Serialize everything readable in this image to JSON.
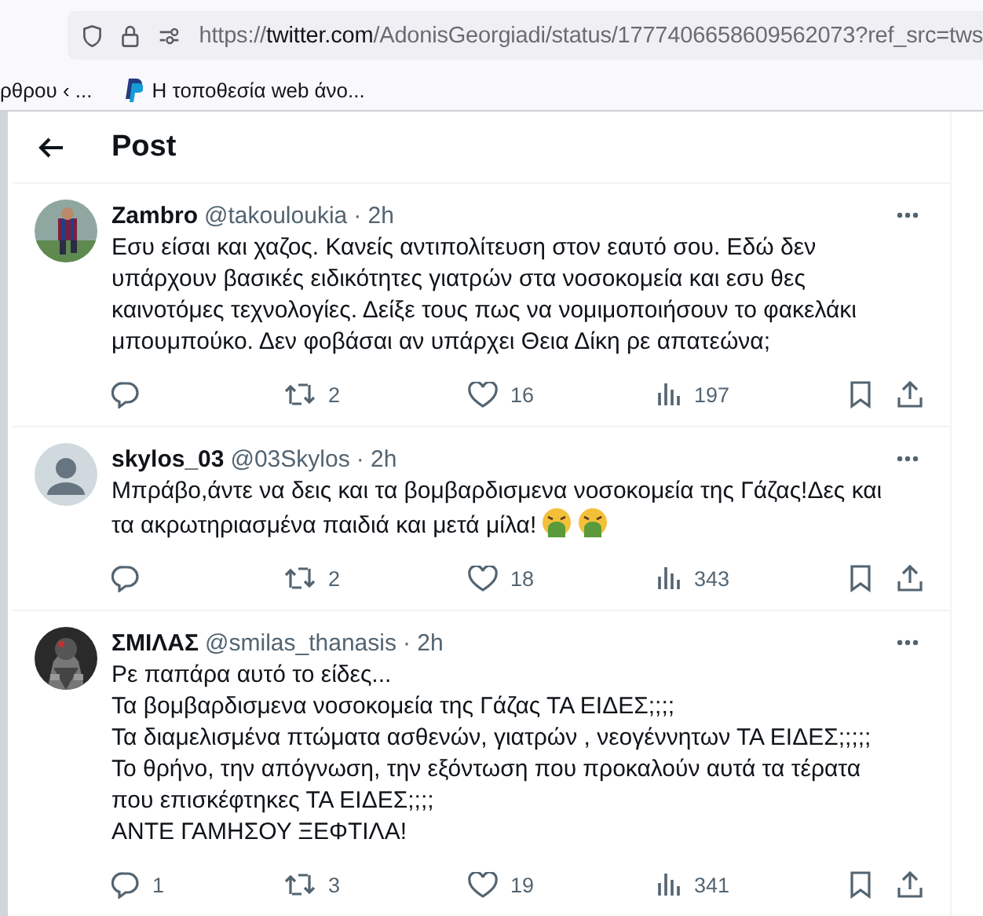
{
  "browser": {
    "url_scheme": "https://",
    "url_host": "twitter.com",
    "url_path": "/AdonisGeorgiadi/status/1777406658609562073?ref_src=tws"
  },
  "bookmarks": [
    {
      "kind": "plain",
      "label": "ρθρου ‹ ..."
    },
    {
      "kind": "paypal",
      "label": "Η τοποθεσία web άνο..."
    }
  ],
  "header": {
    "title": "Post"
  },
  "posts": [
    {
      "name": "Zambro",
      "handle": "@takouloukia",
      "time": "· 2h",
      "lines": [
        "Εσυ είσαι και χαζος. Κανείς αντιπολίτευση στον εαυτό σου. Εδώ δεν",
        "υπάρχουν βασικές ειδικότητες γιατρών στα νοσοκομεία και εσυ θες",
        "καινοτόμες τεχνολογίες. Δείξε τους πως να νομιμοποιήσουν το φακελάκι",
        "μπουμπούκο. Δεν φοβάσαι αν υπάρχει Θεια Δίκη ρε απατεώνα;"
      ],
      "reposts": "2",
      "likes": "16",
      "views": "197"
    },
    {
      "avatar": {
        "kind": "default"
      },
      "name": "skylos_03",
      "handle": "@03Skylos",
      "time": "· 2h",
      "lines": [
        "Μπράβο,άντε να δεις και τα βομβαρδισμενα νοσοκομεία της Γάζας!Δες και",
        "τα ακρωτηριασμένα παιδιά και μετά μίλα!"
      ],
      "emojis": [
        {
          "kind": "vomiting-face"
        },
        {
          "kind": "vomiting-face"
        }
      ],
      "reposts": "2",
      "likes": "18",
      "views": "343"
    },
    {
      "avatar": {
        "kind": "dark"
      },
      "name": "ΣΜΙΛΑΣ",
      "handle": "@smilas_thanasis",
      "time": "· 2h",
      "lines": [
        "Ρε παπάρα αυτό το είδες...",
        "Τα βομβαρδισμενα νοσοκομεία της Γάζας ΤΑ ΕΙΔΕΣ;;;;",
        "Τα διαμελισμένα πτώματα ασθενών, γιατρών , νεογέννητων ΤΑ ΕΙΔΕΣ;;;;;",
        "Το θρήνο, την απόγνωση, την εξόντωση που προκαλούν αυτά τα τέρατα",
        "που επισκέφτηκες ΤΑ ΕΙΔΕΣ;;;;",
        "ΑΝΤΕ ΓΑΜΗΣΟΥ ΞΕΦΤΙΛΑ!"
      ],
      "replies": "1",
      "reposts": "3",
      "likes": "19",
      "views": "341"
    }
  ]
}
